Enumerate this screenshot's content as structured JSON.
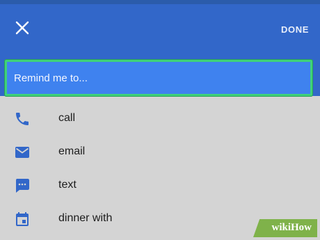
{
  "header": {
    "close_icon": "close-icon",
    "done_label": "DONE"
  },
  "reminder": {
    "placeholder": "Remind me to..."
  },
  "suggestions": [
    {
      "icon": "phone-icon",
      "label": "call"
    },
    {
      "icon": "email-icon",
      "label": "email"
    },
    {
      "icon": "message-icon",
      "label": "text"
    },
    {
      "icon": "calendar-icon",
      "label": "dinner with"
    }
  ],
  "watermark": {
    "text": "wikiHow"
  },
  "colors": {
    "appbar": "#3267c9",
    "input_bg": "#3f82ef",
    "highlight": "#3fd27a",
    "icon": "#3267c9",
    "list_bg": "#d4d4d4"
  }
}
